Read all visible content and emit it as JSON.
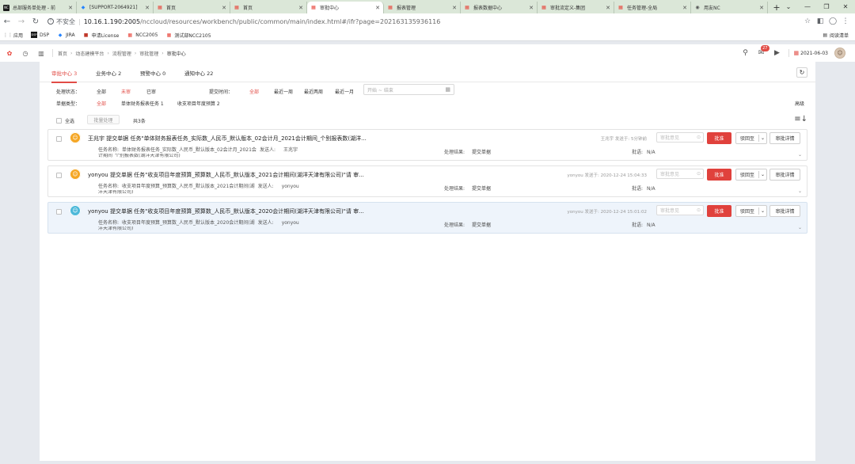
{
  "browser": {
    "tabs": [
      {
        "title": "总部服务单处理 - 前",
        "icon": "NC",
        "icon_bg": "#1a1a1a",
        "icon_fg": "#ffffff"
      },
      {
        "title": "[SUPPORT-2064921]",
        "icon": "◆",
        "icon_bg": "transparent",
        "icon_fg": "#2684ff"
      },
      {
        "title": "首页",
        "icon": "▦",
        "icon_bg": "transparent",
        "icon_fg": "#e8443a"
      },
      {
        "title": "首页",
        "icon": "▦",
        "icon_bg": "transparent",
        "icon_fg": "#e8443a"
      },
      {
        "title": "审批中心",
        "icon": "▦",
        "icon_bg": "transparent",
        "icon_fg": "#e8443a"
      },
      {
        "title": "报表管理",
        "icon": "▦",
        "icon_bg": "transparent",
        "icon_fg": "#e8443a"
      },
      {
        "title": "报表数据中心",
        "icon": "▦",
        "icon_bg": "transparent",
        "icon_fg": "#e8443a"
      },
      {
        "title": "审批流定义-集团",
        "icon": "▦",
        "icon_bg": "transparent",
        "icon_fg": "#e8443a"
      },
      {
        "title": "任务管理-全局",
        "icon": "▦",
        "icon_bg": "transparent",
        "icon_fg": "#e8443a"
      },
      {
        "title": "用友NC",
        "icon": "◉",
        "icon_bg": "transparent",
        "icon_fg": "#555555"
      }
    ],
    "active_tab": 4,
    "insecure_label": "不安全",
    "url_host": "10.16.1.190:2005",
    "url_path": "/nccloud/resources/workbench/public/common/main/index.html#/ifr?page=202163135936116",
    "bookmarks": [
      {
        "label": "应用",
        "icon": "⋮⋮",
        "color": "#555555"
      },
      {
        "label": "DSP",
        "icon": "DSP",
        "color": "#1a1a1a"
      },
      {
        "label": "JIRA",
        "icon": "◆",
        "color": "#2684ff"
      },
      {
        "label": "申请License",
        "icon": "■",
        "color": "#c0392b"
      },
      {
        "label": "NCC2005",
        "icon": "▦",
        "color": "#e8443a"
      },
      {
        "label": "测试部NCC2105",
        "icon": "▦",
        "color": "#e8443a"
      }
    ],
    "reading_list": "阅读清单"
  },
  "app": {
    "breadcrumbs": [
      "首页",
      "动态建模平台",
      "流程管理",
      "审批管理",
      "审批中心"
    ],
    "message_badge": "27",
    "date": "2021-06-03"
  },
  "main_tabs": [
    {
      "label": "审批中心",
      "count": "3"
    },
    {
      "label": "业务中心",
      "count": "2"
    },
    {
      "label": "预警中心",
      "count": "0"
    },
    {
      "label": "通知中心",
      "count": "22"
    }
  ],
  "filters": {
    "status_label": "处理状态：",
    "status_options": [
      "全部",
      "未审",
      "已审"
    ],
    "status_selected": 1,
    "time_label": "提交时间：",
    "time_options": [
      "全部",
      "最近一周",
      "最近两周",
      "最近一月"
    ],
    "time_selected": 0,
    "date_placeholder": "开始 ~ 结束",
    "doc_type_label": "单据类型：",
    "doc_type_options": [
      "全部",
      "单体财务报表任务 1",
      "收支项目年度预算 2"
    ],
    "doc_type_selected": 0,
    "advanced": "高级"
  },
  "toolbar": {
    "select_all": "全选",
    "batch": "批量处理",
    "count": "共3条"
  },
  "labels": {
    "task_name": "任务名称:",
    "sender": "发送人:",
    "result": "处理结果:",
    "batch": "批语:",
    "opinion_placeholder": "审批意见",
    "approve": "批准",
    "reject": "驳回至",
    "detail": "审批详情"
  },
  "items": [
    {
      "title": "王兆宇 提交单据 任务\"单体财务报表任务_实际数_人民币_默认版本_02会计月_2021会计期间_个别报表数(湖洋...",
      "sender_time": "王兆宇 发送于:  5分钟前",
      "task_name": "单体财务报表任务_实际数_人民币_默认版本_02会计月_2021会",
      "sender": "王兆宇",
      "company": "计期间_个别报表数(湖洋天津有限公司)",
      "result": "提交单据",
      "batch": "N/A",
      "avatar_color": "#f5a623",
      "highlight": false
    },
    {
      "title": "yonyou 提交单据 任务\"收支项目年度预算_预算数_人民币_默认版本_2021会计期间(湖洋天津有限公司)\"请 审...",
      "sender_time": "yonyou 发送于:  2020-12-24 15:04:33",
      "task_name": "收支项目年度预算_预算数_人民币_默认版本_2021会计期间(湖",
      "sender": "yonyou",
      "company": "洋天津有限公司)",
      "result": "提交单据",
      "batch": "N/A",
      "avatar_color": "#f5a623",
      "highlight": false
    },
    {
      "title": "yonyou 提交单据 任务\"收支项目年度预算_预算数_人民币_默认版本_2020会计期间(湖洋天津有限公司)\"请 审...",
      "sender_time": "yonyou 发送于:  2020-12-24 15:01:02",
      "task_name": "收支项目年度预算_预算数_人民币_默认版本_2020会计期间(湖",
      "sender": "yonyou",
      "company": "洋天津有限公司)",
      "result": "提交单据",
      "batch": "N/A",
      "avatar_color": "#4cb8d9",
      "highlight": true
    }
  ]
}
